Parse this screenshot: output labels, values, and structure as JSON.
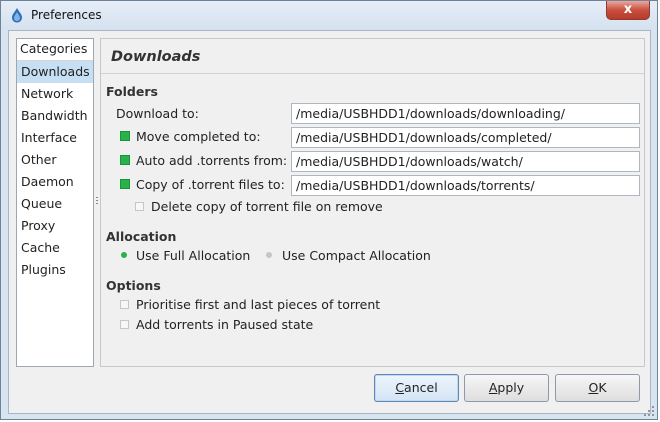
{
  "window": {
    "title": "Preferences",
    "close_label": "x"
  },
  "categories": {
    "header": "Categories",
    "items": [
      {
        "label": "Downloads",
        "selected": true
      },
      {
        "label": "Network"
      },
      {
        "label": "Bandwidth"
      },
      {
        "label": "Interface"
      },
      {
        "label": "Other"
      },
      {
        "label": "Daemon"
      },
      {
        "label": "Queue"
      },
      {
        "label": "Proxy"
      },
      {
        "label": "Cache"
      },
      {
        "label": "Plugins"
      }
    ]
  },
  "panel": {
    "heading": "Downloads",
    "folders": {
      "title": "Folders",
      "download_to_label": "Download to:",
      "download_to_value": "/media/USBHDD1/downloads/downloading/",
      "move_completed_label": "Move completed to:",
      "move_completed_value": "/media/USBHDD1/downloads/completed/",
      "move_completed_checked": true,
      "auto_add_label": "Auto add .torrents from:",
      "auto_add_value": "/media/USBHDD1/downloads/watch/",
      "auto_add_checked": true,
      "copy_torrent_label": "Copy of .torrent files to:",
      "copy_torrent_value": "/media/USBHDD1/downloads/torrents/",
      "copy_torrent_checked": true,
      "delete_copy_label": "Delete copy of torrent file on remove",
      "delete_copy_checked": false
    },
    "allocation": {
      "title": "Allocation",
      "full_label": "Use Full Allocation",
      "compact_label": "Use Compact Allocation",
      "selected": "full"
    },
    "options": {
      "title": "Options",
      "prioritise_label": "Prioritise first and last pieces of torrent",
      "prioritise_checked": false,
      "paused_label": "Add torrents in Paused state",
      "paused_checked": false
    }
  },
  "buttons": {
    "cancel_first": "C",
    "cancel_rest": "ancel",
    "apply_first": "A",
    "apply_rest": "pply",
    "ok_first": "O",
    "ok_rest": "K"
  },
  "colors": {
    "accent_green": "#27b34a",
    "selection": "#c7dff3",
    "close_red": "#c9503f"
  }
}
